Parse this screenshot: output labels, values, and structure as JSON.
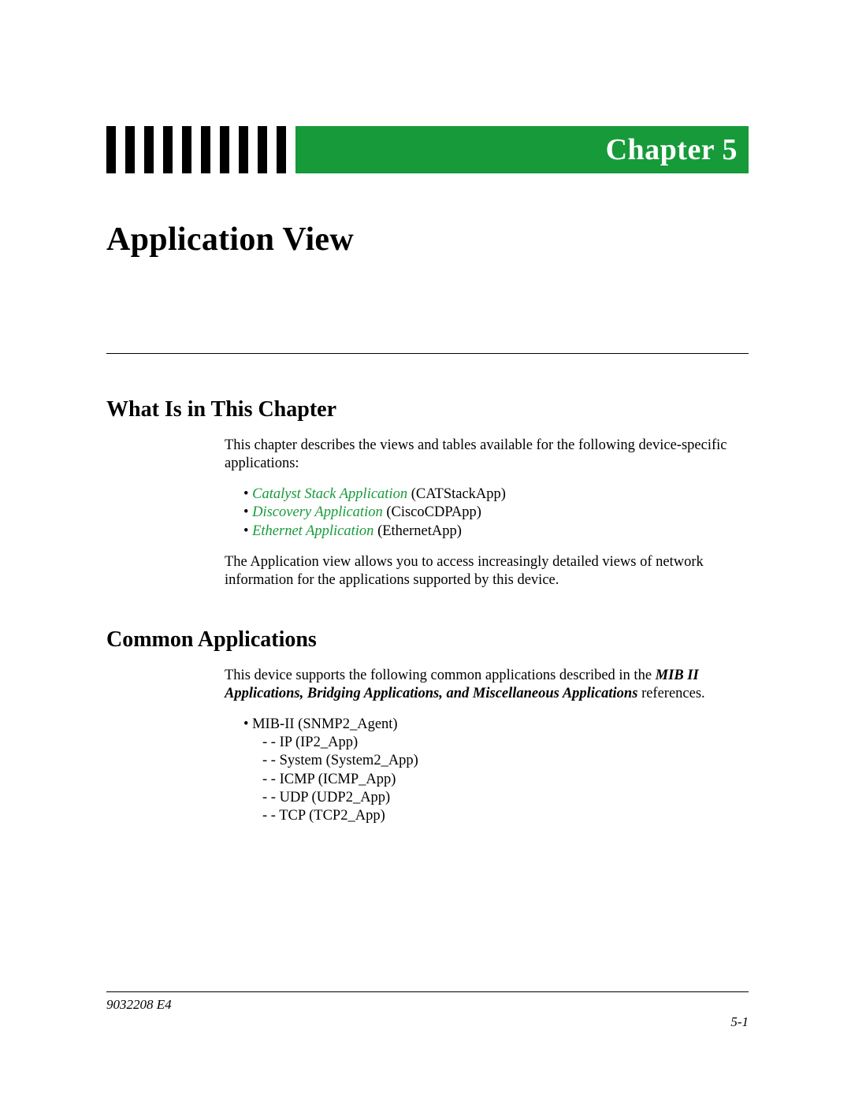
{
  "chapter": {
    "label": "Chapter 5"
  },
  "title": "Application View",
  "section1": {
    "heading": "What Is in This Chapter",
    "intro": "This chapter describes the views and tables available for the following device-specific applications:",
    "items": [
      {
        "link": "Catalyst Stack Application",
        "tail": " (CATStackApp)"
      },
      {
        "link": "Discovery Application",
        "tail": " (CiscoCDPApp)"
      },
      {
        "link": "Ethernet Application",
        "tail": " (EthernetApp)"
      }
    ],
    "outro": "The Application view allows you to access increasingly detailed views of network information for the applications supported by this device."
  },
  "section2": {
    "heading": "Common Applications",
    "para_lead": "This device supports the following common applications described in the ",
    "para_bold": "MIB II Applications, Bridging Applications, and Miscellaneous Applications",
    "para_tail": " references.",
    "toplist_item": "MIB-II (SNMP2_Agent)",
    "sublist": [
      "IP (IP2_App)",
      "System (System2_App)",
      "ICMP (ICMP_App)",
      "UDP (UDP2_App)",
      "TCP (TCP2_App)"
    ]
  },
  "footer": {
    "doc_id": "9032208 E4",
    "page_num": "5-1"
  }
}
